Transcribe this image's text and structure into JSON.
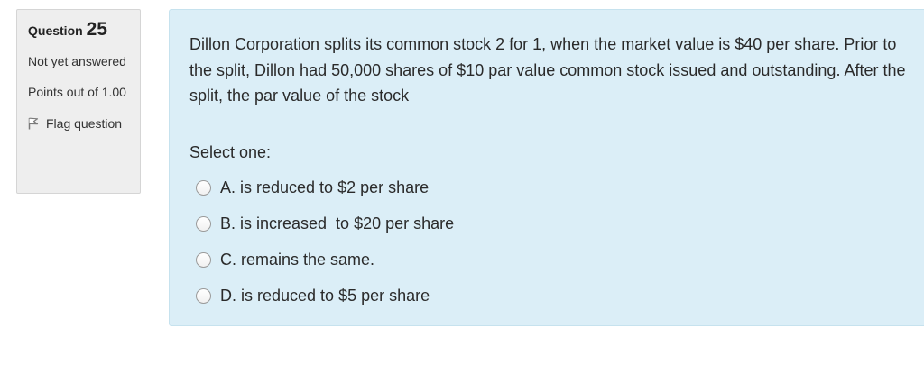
{
  "info": {
    "question_label": "Question",
    "question_number": "25",
    "state": "Not yet answered",
    "grade": "Points out of 1.00",
    "flag_label": "Flag question",
    "flag_icon": "flag-icon"
  },
  "question": {
    "text": "Dillon Corporation splits its common stock 2 for 1, when the market value is $40 per share. Prior to the split, Dillon had 50,000 shares of $10 par value common stock issued and outstanding. After the split, the par value of the stock",
    "prompt": "Select one:",
    "options": [
      {
        "label": "A. is reduced to $2 per share",
        "selected": false
      },
      {
        "label": "B. is increased  to $20 per share",
        "selected": false
      },
      {
        "label": "C. remains the same.",
        "selected": false
      },
      {
        "label": "D. is reduced to $5 per share",
        "selected": false
      }
    ]
  },
  "colors": {
    "content_bg": "#dbeef7",
    "info_bg": "#eeeeee"
  }
}
